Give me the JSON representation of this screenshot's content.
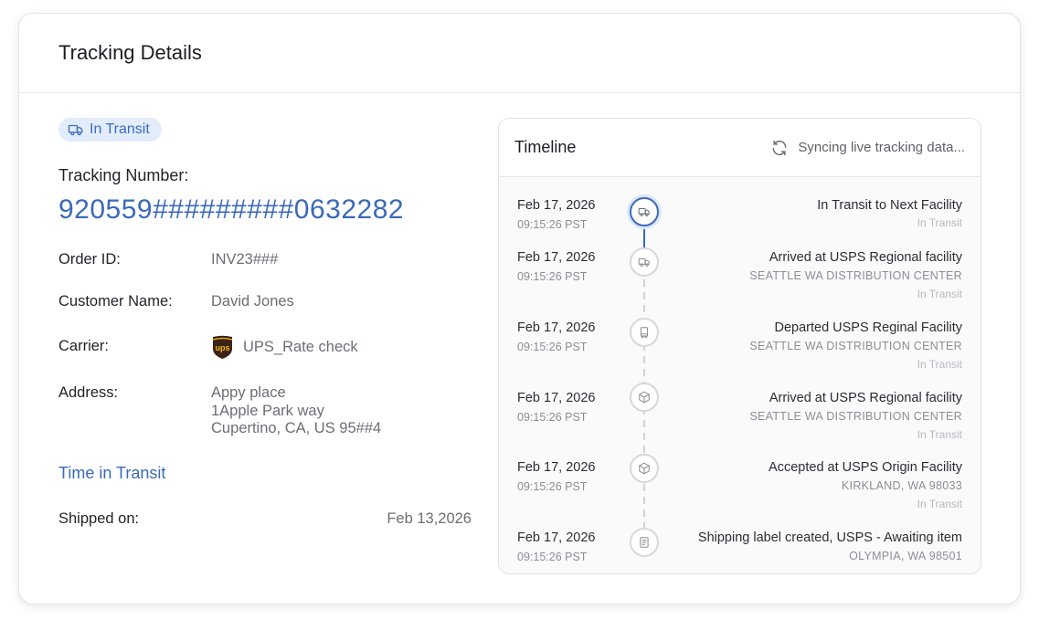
{
  "card": {
    "title": "Tracking Details"
  },
  "status_badge": {
    "label": "In Transit",
    "icon": "truck-icon"
  },
  "tracking": {
    "label": "Tracking Number:",
    "number": "920559#########0632282"
  },
  "fields": {
    "order_id": {
      "label": "Order ID:",
      "value": "INV23###"
    },
    "customer": {
      "label": "Customer Name:",
      "value": "David Jones"
    },
    "carrier": {
      "label": "Carrier:",
      "value": "UPS_Rate check",
      "logo": "ups-logo",
      "logo_text": "ups"
    },
    "address": {
      "label": "Address:",
      "line1": "Appy place",
      "line2": "1Apple Park way",
      "line3": "Cupertino, CA, US 95##4"
    }
  },
  "time_in_transit": {
    "title": "Time in Transit",
    "shipped_label": "Shipped on:",
    "shipped_value": "Feb 13,2026"
  },
  "timeline": {
    "title": "Timeline",
    "sync_text": "Syncing live tracking data...",
    "events": [
      {
        "date": "Feb 17, 2026",
        "time": "09:15:26 PST",
        "title": "In Transit to Next Facility",
        "location": "",
        "status": "In Transit",
        "icon": "truck-icon"
      },
      {
        "date": "Feb 17, 2026",
        "time": "09:15:26 PST",
        "title": "Arrived at USPS Regional facility",
        "location": "SEATTLE WA DISTRIBUTION CENTER",
        "status": "In Transit",
        "icon": "truck-icon"
      },
      {
        "date": "Feb 17, 2026",
        "time": "09:15:26 PST",
        "title": "Departed USPS Reginal Facility",
        "location": "SEATTLE WA DISTRIBUTION CENTER",
        "status": "In Transit",
        "icon": "cart-icon"
      },
      {
        "date": "Feb 17, 2026",
        "time": "09:15:26 PST",
        "title": "Arrived at USPS Regional facility",
        "location": "SEATTLE WA DISTRIBUTION CENTER",
        "status": "In Transit",
        "icon": "package-icon"
      },
      {
        "date": "Feb 17, 2026",
        "time": "09:15:26 PST",
        "title": "Accepted at USPS Origin Facility",
        "location": "KIRKLAND, WA 98033",
        "status": "In Transit",
        "icon": "package-icon"
      },
      {
        "date": "Feb 17, 2026",
        "time": "09:15:26 PST",
        "title": "Shipping label created, USPS - Awaiting item",
        "location": "OLYMPIA, WA 98501",
        "status": "",
        "icon": "label-icon"
      }
    ]
  },
  "colors": {
    "accent": "#3a6ab8",
    "badge_bg": "#e3ecfa",
    "ups_brown": "#3b2315",
    "ups_gold": "#f6b717"
  }
}
